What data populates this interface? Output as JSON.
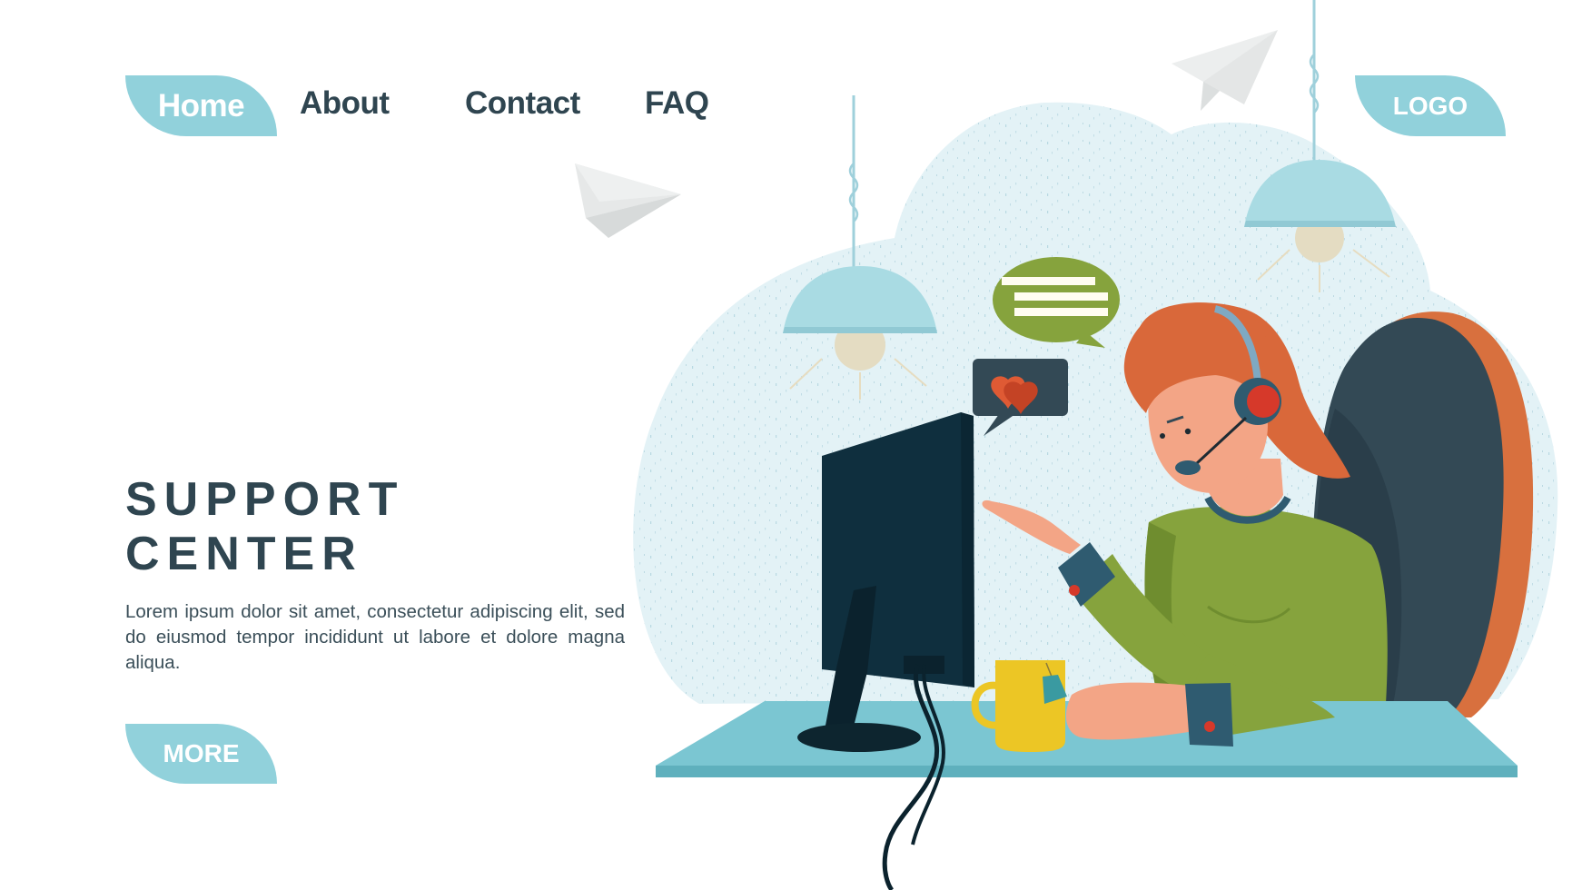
{
  "nav": {
    "items": [
      {
        "label": "Home",
        "active": true
      },
      {
        "label": "About",
        "active": false
      },
      {
        "label": "Contact",
        "active": false
      },
      {
        "label": "FAQ",
        "active": false
      }
    ]
  },
  "logo": {
    "label": "LOGO"
  },
  "hero": {
    "title_line1": "SUPPORT",
    "title_line2": "CENTER",
    "body": "Lorem ipsum dolor sit amet, consectetur adipiscing elit, sed do eiusmod tempor incididunt ut labore et dolore magna aliqua.",
    "cta_label": "MORE"
  },
  "illustration": {
    "subject": "customer support agent with headset at computer desk",
    "icons": [
      "paper-plane-icon",
      "paper-plane-icon",
      "pendant-lamp-icon",
      "pendant-lamp-icon",
      "chat-bubble-icon",
      "heart-message-icon",
      "monitor-icon",
      "mug-icon",
      "office-chair-icon"
    ]
  },
  "colors": {
    "accent": "#91d1db",
    "text_dark": "#2f4550",
    "cloud": "#e3f2f6",
    "desk": "#7bc6d2",
    "sweater": "#86a33d",
    "hair": "#d9683a",
    "chair_back": "#334955",
    "chair_rim": "#d8703e",
    "monitor": "#0f2f3e",
    "bubble_green": "#86a33d",
    "bubble_dark": "#334955",
    "heart": "#d04a2c",
    "mug": "#ecc625"
  }
}
